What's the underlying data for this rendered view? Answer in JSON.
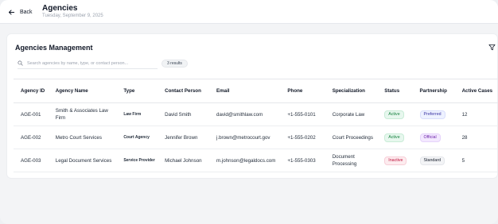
{
  "header": {
    "back_label": "Back",
    "title": "Agencies",
    "date": "Tuesday, September 9, 2025"
  },
  "card": {
    "title": "Agencies Management",
    "filter_icon": "filter-icon"
  },
  "search": {
    "placeholder": "Search agencies by name, type, or contact person...",
    "value": "",
    "results_badge": "3 results"
  },
  "table": {
    "columns": {
      "id": "Agency ID",
      "name": "Agency Name",
      "type": "Type",
      "contact": "Contact Person",
      "email": "Email",
      "phone": "Phone",
      "specialization": "Specialization",
      "status": "Status",
      "partnership": "Partnership",
      "active_cases": "Active Cases"
    },
    "rows": [
      {
        "id": "AGE-001",
        "name": "Smith & Associates Law Firm",
        "type": "Law Firm",
        "contact": "David Smith",
        "email": "david@smithlaw.com",
        "phone": "+1-555-0101",
        "specialization": "Corporate Law",
        "status": "Active",
        "partnership": "Preferred",
        "active_cases": "12"
      },
      {
        "id": "AGE-002",
        "name": "Metro Court Services",
        "type": "Court Agency",
        "contact": "Jennifer Brown",
        "email": "j.brown@metrocourt.gov",
        "phone": "+1-555-0202",
        "specialization": "Court Proceedings",
        "status": "Active",
        "partnership": "Official",
        "active_cases": "28"
      },
      {
        "id": "AGE-003",
        "name": "Legal Document Services",
        "type": "Service Provider",
        "contact": "Michael Johnson",
        "email": "m.johnson@legaldocs.com",
        "phone": "+1-555-0303",
        "specialization": "Document Processing",
        "status": "Inactive",
        "partnership": "Standard",
        "active_cases": "5"
      }
    ]
  },
  "colors": {
    "active": "#15803d",
    "inactive": "#be123c",
    "preferred": "#3730a3",
    "official": "#6b21a8",
    "standard": "#111827"
  }
}
